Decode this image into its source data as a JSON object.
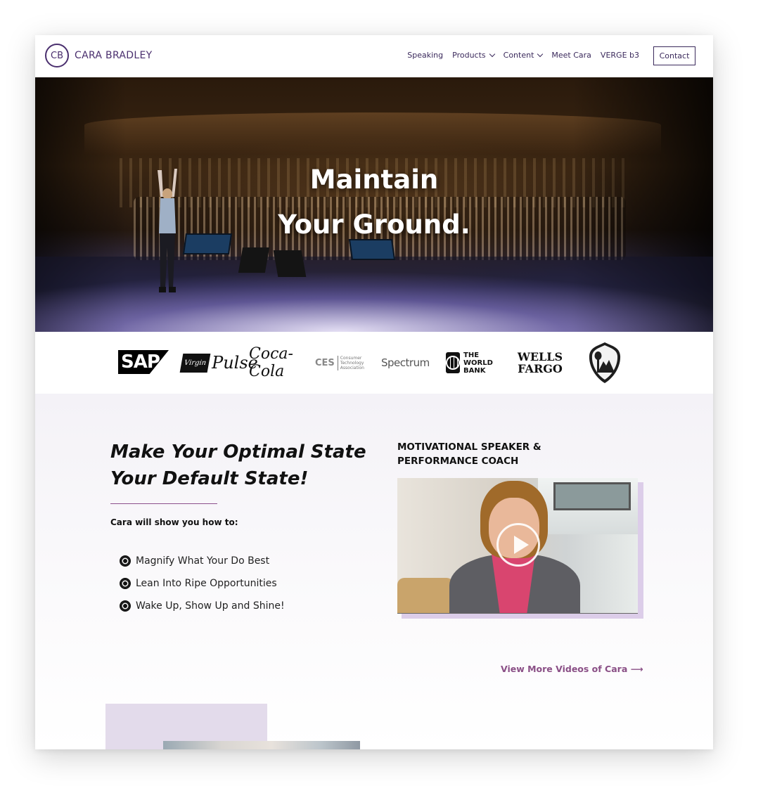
{
  "brand": {
    "mark": "CB",
    "name": "CARA BRADLEY",
    "color": "#4a2f6e"
  },
  "nav": {
    "items": [
      {
        "label": "Speaking",
        "dropdown": false
      },
      {
        "label": "Products",
        "dropdown": true
      },
      {
        "label": "Content",
        "dropdown": true
      },
      {
        "label": "Meet Cara",
        "dropdown": false
      },
      {
        "label": "VERGE b3",
        "dropdown": false
      }
    ],
    "contact_label": "Contact"
  },
  "hero": {
    "line1": "Maintain",
    "line2": "Your Ground."
  },
  "clients": [
    {
      "name": "SAP",
      "icon": "sap-logo"
    },
    {
      "name": "Pulse",
      "icon": "virgin-pulse-logo"
    },
    {
      "name": "Coca-Cola",
      "icon": "coca-cola-logo"
    },
    {
      "name": "CES",
      "icon": "ces-logo",
      "sub": "Consumer Technology Association"
    },
    {
      "name": "Spectrum",
      "icon": "spectrum-logo"
    },
    {
      "name": "THE WORLD BANK",
      "icon": "world-bank-logo"
    },
    {
      "name": "WELLS FARGO",
      "icon": "wells-fargo-logo"
    },
    {
      "name": "NATIONAL PARK SERVICE",
      "icon": "nps-arrowhead-logo"
    }
  ],
  "intro": {
    "headline": "Make Your Optimal State Your Default State!",
    "lead": "Cara will show you how to:",
    "bullets": [
      "Magnify What Your Do Best",
      "Lean Into Ripe Opportunities",
      "Wake Up, Show Up and Shine!"
    ]
  },
  "video": {
    "title": "MOTIVATIONAL SPEAKER & PERFORMANCE COACH",
    "more_link": "View More Videos of Cara ⟶",
    "accent_color": "#8a4f86"
  }
}
